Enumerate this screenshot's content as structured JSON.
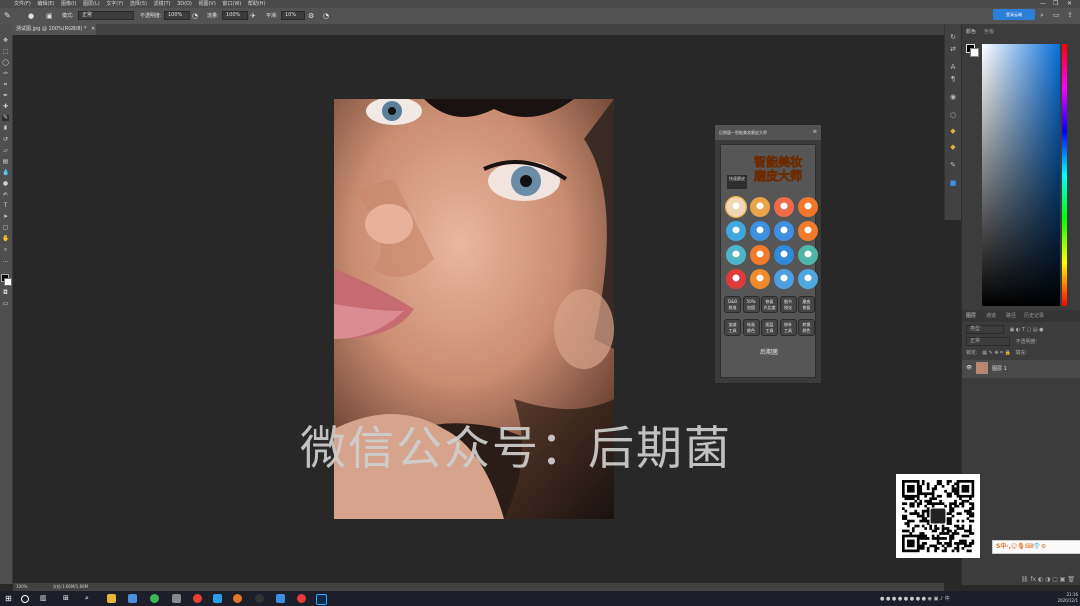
{
  "menubar": {
    "items": [
      "文件(F)",
      "编辑(E)",
      "图像(I)",
      "图层(L)",
      "文字(Y)",
      "选择(S)",
      "滤镜(T)",
      "3D(D)",
      "视图(V)",
      "窗口(W)",
      "帮助(H)"
    ],
    "window_controls": [
      "—",
      "❐",
      "✕"
    ]
  },
  "options": {
    "mode_label": "模式:",
    "mode_value": "正常",
    "opacity_label": "不透明度:",
    "opacity_value": "100%",
    "flow_label": "流量:",
    "flow_value": "100%",
    "smooth_label": "平滑:",
    "smooth_value": "10%"
  },
  "document": {
    "tab_title": "测试图.jpg @ 100%(RGB/8) *",
    "watermark": "微信公众号：后期菌"
  },
  "plugin": {
    "header": "后期菌—智能美妆磨皮大师",
    "title_line1": "智能美妆",
    "title_line2": "磨皮大师",
    "quick_tab": "快速磨皮",
    "icon_colors": [
      "#f2d7b5",
      "#e8a34b",
      "#f06a4a",
      "#f0762a",
      "#3fa7e0",
      "#3f8fe0",
      "#3f8fe0",
      "#f07a2a",
      "#4fb5c9",
      "#f07a2a",
      "#2f8ad8",
      "#4fb5a8",
      "#e03b3b",
      "#f08a2a",
      "#4f9fe0",
      "#4fa7e0"
    ],
    "rect_row1": [
      "D&B\n校准",
      "50%\n加固",
      "修复\n光比度",
      "细节\n锐化",
      "磨皮\n修复"
    ],
    "rect_row2": [
      "加减\n工具",
      "绘画\n颜色",
      "图层\n工具",
      "修补\n工具",
      "转换\n颜色"
    ],
    "brand": "后期菌"
  },
  "panels": {
    "color_tabs": [
      "颜色",
      "色板"
    ],
    "layer_tabs": [
      "图层",
      "通道",
      "路径",
      "历史记录"
    ],
    "layer_kind": "类型",
    "layer_mode": "正常",
    "layer_opacity": "不透明度:",
    "layer_lock": "锁定:",
    "layer_fill": "填充:",
    "layer_name": "图层 1"
  },
  "status": {
    "zoom": "100%",
    "doc_size": "文档:1.66M/1.66M"
  },
  "taskbar": {
    "time": "21:16",
    "date": "2020/12/1"
  },
  "topright": {
    "badge": "登录云端"
  },
  "ime": {
    "text": "S中·,☺🎙⌨👕⚙"
  }
}
